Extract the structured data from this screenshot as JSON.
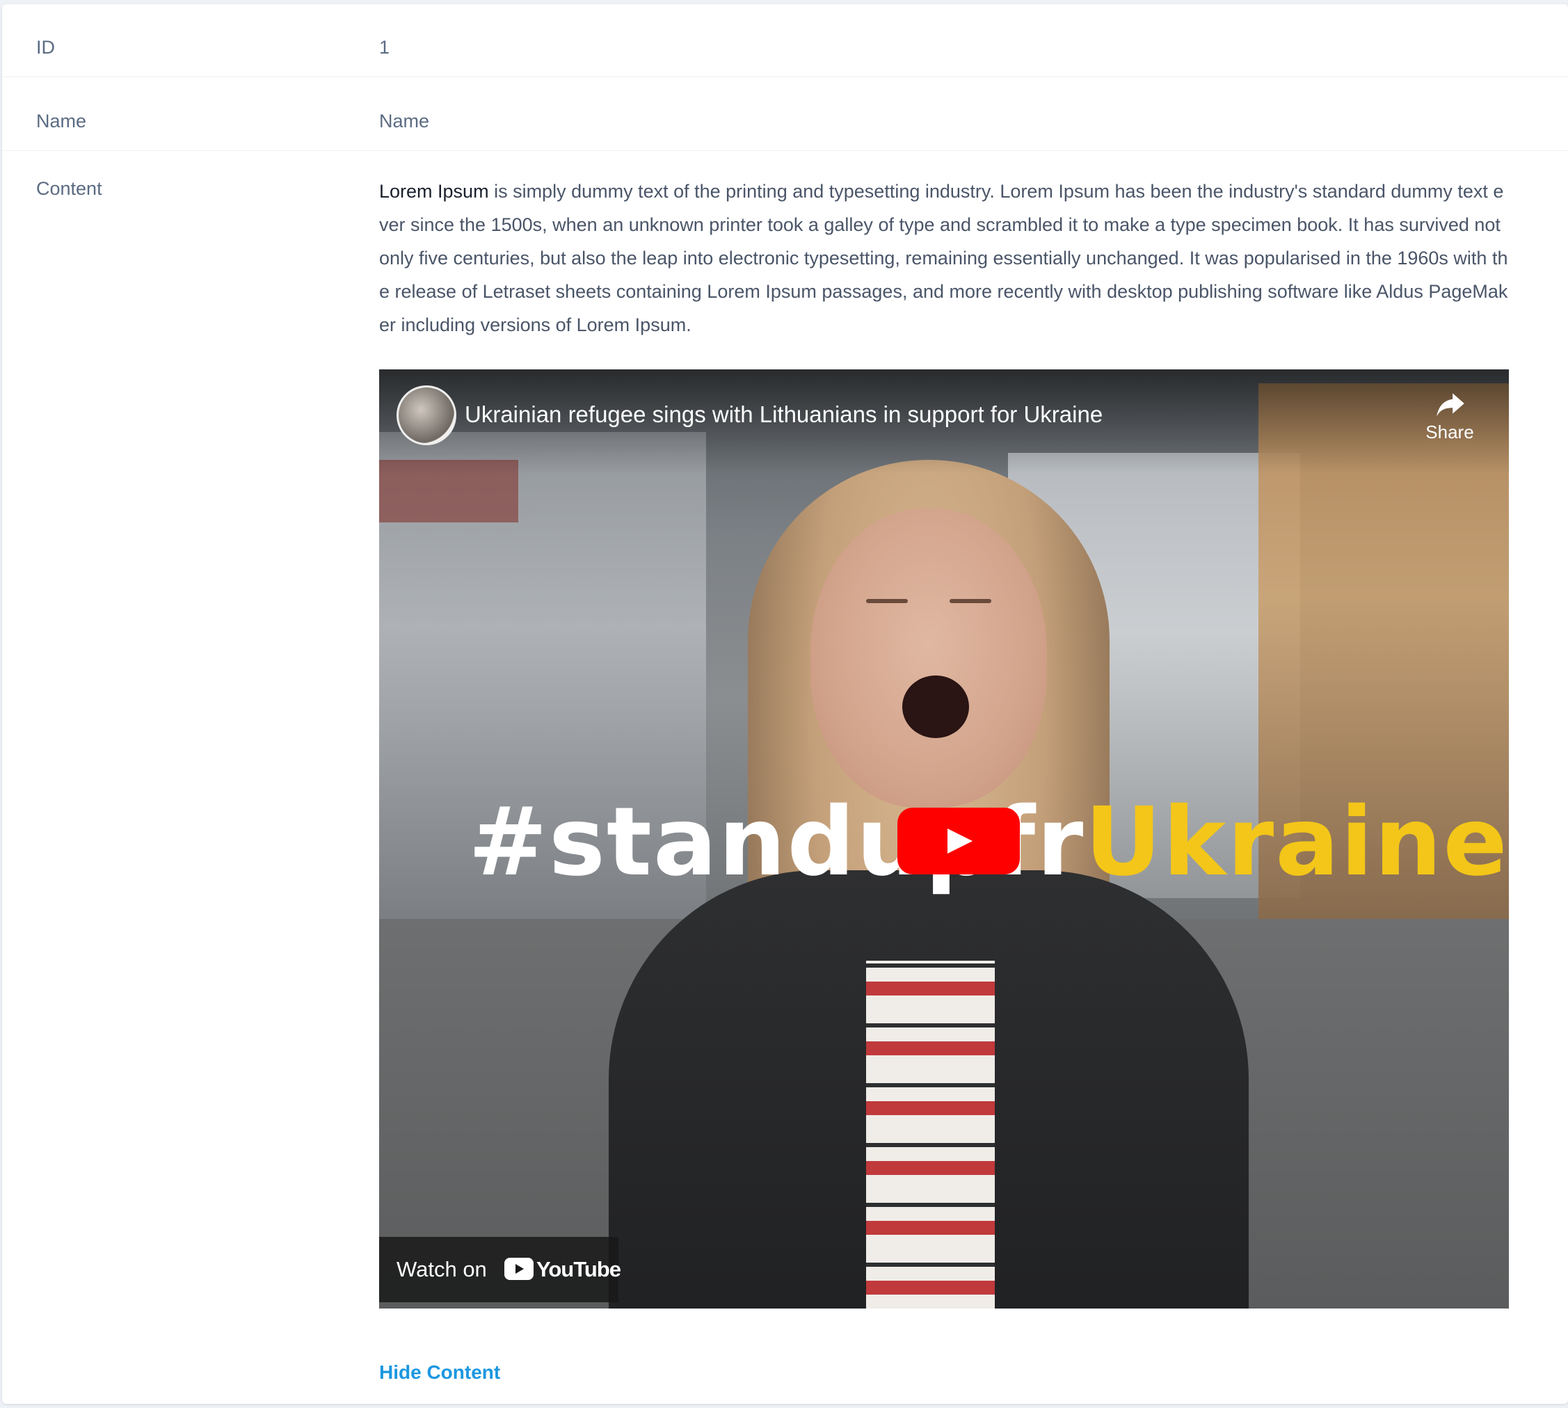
{
  "fields": {
    "id": {
      "label": "ID",
      "value": "1"
    },
    "name": {
      "label": "Name",
      "value": "Name"
    },
    "content": {
      "label": "Content",
      "lead": "Lorem Ipsum",
      "text": " is simply dummy text of the printing and typesetting industry. Lorem Ipsum has been the industry's standard dummy text ever since the 1500s, when an unknown printer took a galley of type and scrambled it to make a type specimen book. It has survived not only five centuries, but also the leap into electronic typesetting, remaining essentially unchanged. It was popularised in the 1960s with the release of Letraset sheets containing Lorem Ipsum passages, and more recently with desktop publishing software like Aldus PageMaker including versions of Lorem Ipsum."
    }
  },
  "video": {
    "title": "Ukrainian refugee sings with Lithuanians in support for Ukraine",
    "share_label": "Share",
    "hashtag_white": "#standupf",
    "hashtag_white2": "r",
    "hashtag_yellow": "Ukraine",
    "watch_on_label": "Watch on",
    "youtube_label": "YouTube",
    "play_button_color": "#ff0000",
    "hashtag_accent_color": "#f3c619",
    "icons": [
      "share-icon",
      "play-icon",
      "youtube-logo-icon",
      "channel-avatar"
    ]
  },
  "actions": {
    "hide_content_label": "Hide Content",
    "link_color": "#1c97e0"
  }
}
